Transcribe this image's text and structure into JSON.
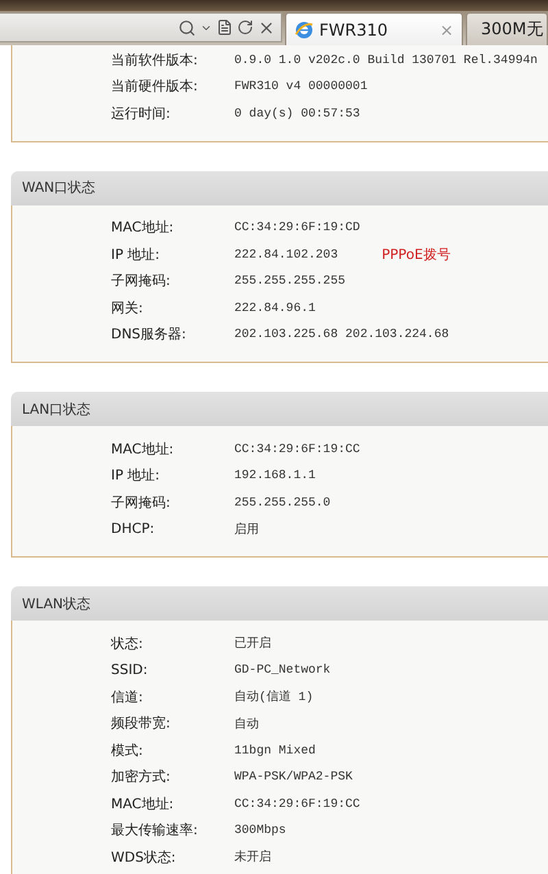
{
  "browser": {
    "tabs": [
      {
        "label": "FWR310",
        "selected": true,
        "close": "×",
        "kind": "ie"
      },
      {
        "label": "300M无",
        "selected": false,
        "kind": "s"
      }
    ]
  },
  "sections": [
    {
      "rows": [
        {
          "label": "当前软件版本:",
          "value": "0.9.0 1.0 v202c.0 Build 130701 Rel.34994n"
        },
        {
          "label": "当前硬件版本:",
          "value": "FWR310 v4 00000001"
        },
        {
          "label": "运行时间:",
          "value": "0 day(s) 00:57:53"
        }
      ]
    },
    {
      "title": "WAN口状态",
      "rows": [
        {
          "label": "MAC地址:",
          "value": "CC:34:29:6F:19:CD"
        },
        {
          "label": "IP 地址:",
          "value": "222.84.102.203",
          "note": "PPPoE拨号"
        },
        {
          "label": "子网掩码:",
          "value": "255.255.255.255"
        },
        {
          "label": "网关:",
          "value": "222.84.96.1"
        },
        {
          "label": "DNS服务器:",
          "value": "202.103.225.68 202.103.224.68"
        }
      ]
    },
    {
      "title": "LAN口状态",
      "rows": [
        {
          "label": "MAC地址:",
          "value": "CC:34:29:6F:19:CC"
        },
        {
          "label": "IP 地址:",
          "value": "192.168.1.1"
        },
        {
          "label": "子网掩码:",
          "value": "255.255.255.0"
        },
        {
          "label": "DHCP:",
          "value": "启用"
        }
      ]
    },
    {
      "title": "WLAN状态",
      "rows": [
        {
          "label": "状态:",
          "value": "已开启"
        },
        {
          "label": "SSID:",
          "value": "GD-PC_Network"
        },
        {
          "label": "信道:",
          "value": "自动(信道 1)"
        },
        {
          "label": "频段带宽:",
          "value": "自动"
        },
        {
          "label": "模式:",
          "value": "11bgn Mixed"
        },
        {
          "label": "加密方式:",
          "value": "WPA-PSK/WPA2-PSK"
        },
        {
          "label": "MAC地址:",
          "value": "CC:34:29:6F:19:CC"
        },
        {
          "label": "最大传输速率:",
          "value": "300Mbps"
        },
        {
          "label": "WDS状态:",
          "value": "未开启"
        }
      ]
    }
  ]
}
